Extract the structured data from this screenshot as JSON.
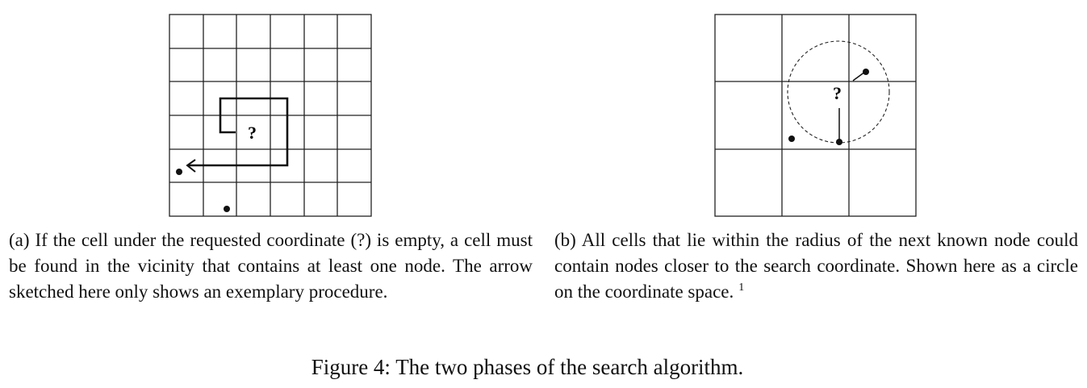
{
  "subfigure_a": {
    "marker": "?",
    "caption": "(a) If the cell under the requested coordinate (?) is empty, a cell must be found in the vicinity that contains at least one node. The arrow sketched here only shows an exemplary procedure."
  },
  "subfigure_b": {
    "marker": "?",
    "caption": "(b) All cells that lie within the radius of the next known node could contain nodes closer to the search coordinate. Shown here as a circle on the coordinate space.",
    "footnote_mark": "1"
  },
  "figure_caption": "Figure 4: The two phases of the search algorithm."
}
